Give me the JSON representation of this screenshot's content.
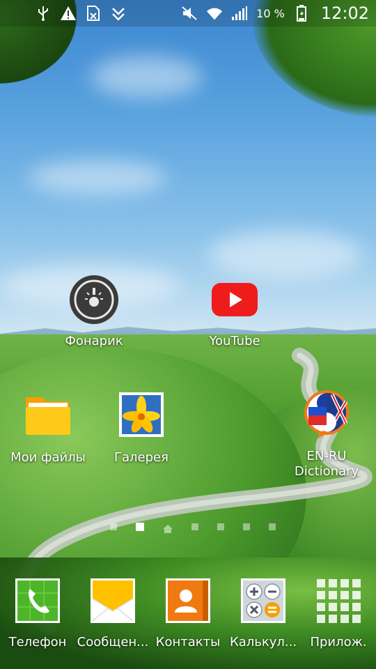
{
  "status_bar": {
    "icons_left": [
      "usb-icon",
      "warning-icon",
      "sim-off-icon",
      "download-done-icon"
    ],
    "icons_right": [
      "mute-icon",
      "wifi-icon",
      "signal-icon"
    ],
    "battery_percent": "10 %",
    "time": "12:02"
  },
  "home": {
    "apps": [
      {
        "label": "Фонарик",
        "icon": "flashlight-icon"
      },
      {
        "label": "YouTube",
        "icon": "youtube-icon"
      },
      {
        "label": "Мои файлы",
        "icon": "folder-icon"
      },
      {
        "label": "Галерея",
        "icon": "gallery-icon"
      },
      {
        "label": "EN-RU\nDictionary",
        "icon": "dictionary-icon"
      }
    ],
    "pages": {
      "count": 7,
      "active": 1,
      "home_index": 2
    }
  },
  "dock": {
    "apps": [
      {
        "label": "Телефон",
        "icon": "phone-icon"
      },
      {
        "label": "Сообщен...",
        "icon": "messages-icon"
      },
      {
        "label": "Контакты",
        "icon": "contacts-icon"
      },
      {
        "label": "Калькул...",
        "icon": "calculator-icon"
      },
      {
        "label": "Прилож.",
        "icon": "apps-grid-icon"
      }
    ]
  }
}
